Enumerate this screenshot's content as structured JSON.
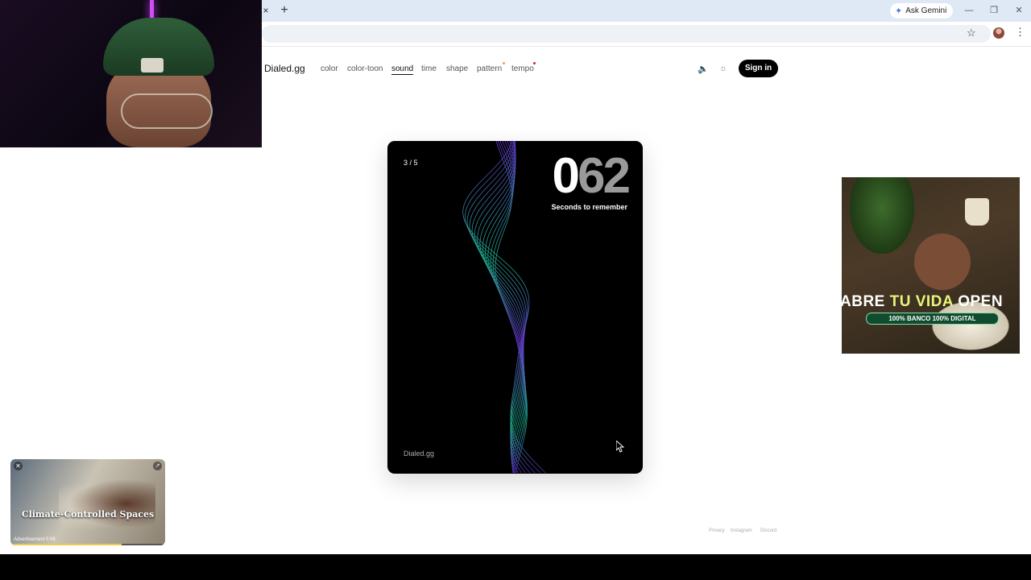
{
  "browser": {
    "ask_gemini": "Ask Gemini",
    "tab_close": "×",
    "new_tab": "+",
    "minimize": "—",
    "restore": "❐",
    "close": "✕",
    "bookmark_icon": "☆",
    "menu_icon": "⋮"
  },
  "site": {
    "logo": "Dialed.gg",
    "nav": [
      {
        "label": "color"
      },
      {
        "label": "color-toon"
      },
      {
        "label": "sound",
        "active": true
      },
      {
        "label": "time"
      },
      {
        "label": "shape"
      },
      {
        "label": "pattern",
        "dot_color": "#f0a040"
      },
      {
        "label": "tempo",
        "dot_color": "#e02020"
      }
    ],
    "volume_icon": "🔈",
    "theme_icon": "☼",
    "sign_in": "Sign in"
  },
  "card": {
    "round": "3 / 5",
    "digit_lit": "0",
    "digits_dim": "62",
    "subtitle": "Seconds to remember",
    "brand": "Dialed.gg"
  },
  "ad_right": {
    "headline_a": "ABRE ",
    "headline_b": "TU VIDA",
    "headline_c": " OPEN",
    "tagline": "100% BANCO 100% DIGITAL"
  },
  "ad_bottom_left": {
    "title": "Climate-Controlled Spaces",
    "label": "Advertisement 0:06",
    "close": "✕",
    "expand": "↗",
    "progress": 0.72
  },
  "footer": {
    "links": [
      "Privacy",
      "Instagram",
      "Discord"
    ]
  }
}
